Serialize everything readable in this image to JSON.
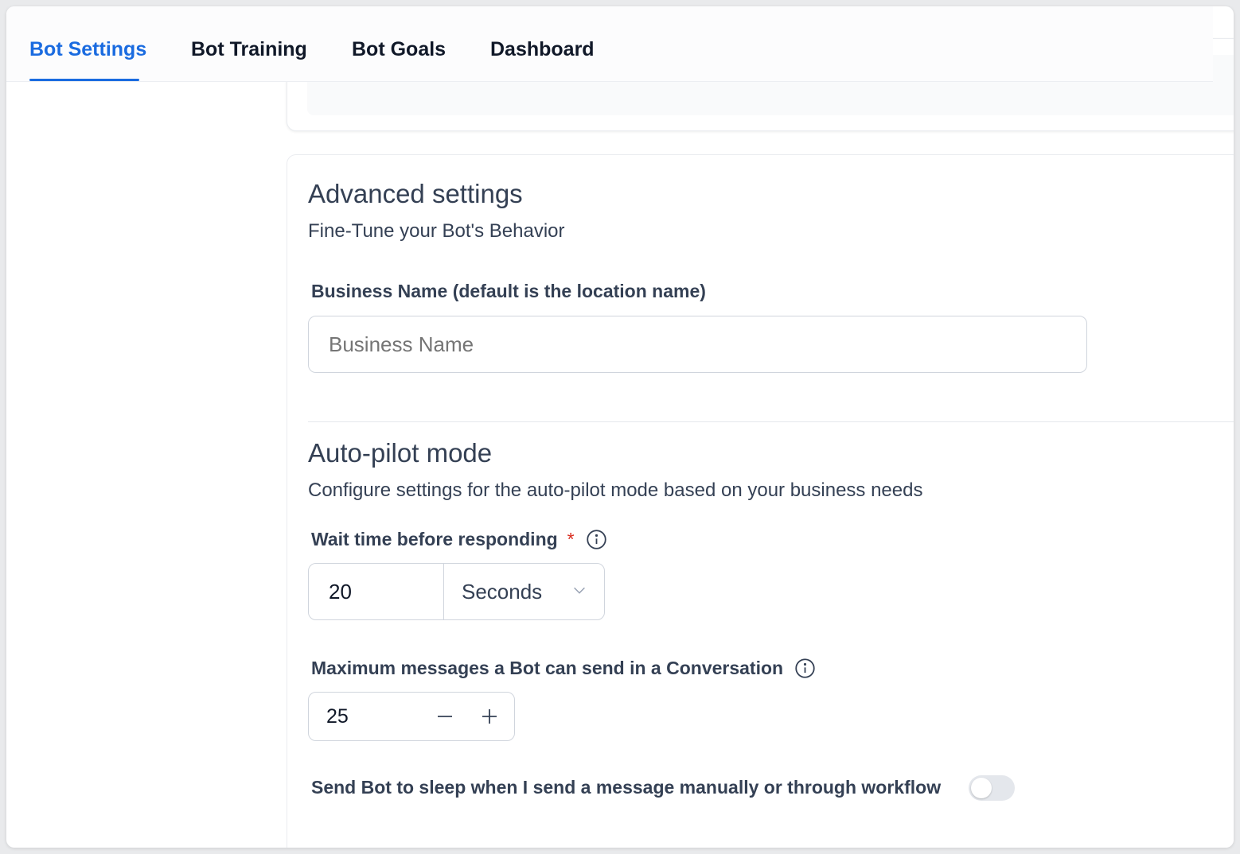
{
  "tabs": [
    {
      "label": "Bot Settings",
      "active": true
    },
    {
      "label": "Bot Training",
      "active": false
    },
    {
      "label": "Bot Goals",
      "active": false
    },
    {
      "label": "Dashboard",
      "active": false
    }
  ],
  "advanced": {
    "title": "Advanced settings",
    "subtitle": "Fine-Tune your Bot's Behavior",
    "business_name_label": "Business Name (default is the location name)",
    "business_name_placeholder": "Business Name",
    "business_name_value": ""
  },
  "autopilot": {
    "title": "Auto-pilot mode",
    "subtitle": "Configure settings for the auto-pilot mode based on your business needs",
    "wait_label": "Wait time before responding",
    "wait_required_mark": "*",
    "wait_value": "20",
    "wait_unit": "Seconds",
    "max_messages_label": "Maximum messages a Bot can send in a Conversation",
    "max_messages_value": "25",
    "sleep_label": "Send Bot to sleep when I send a message manually or through workflow",
    "sleep_enabled": false
  },
  "colors": {
    "accent": "#1a6be0",
    "text": "#344054",
    "required": "#d92d20"
  }
}
